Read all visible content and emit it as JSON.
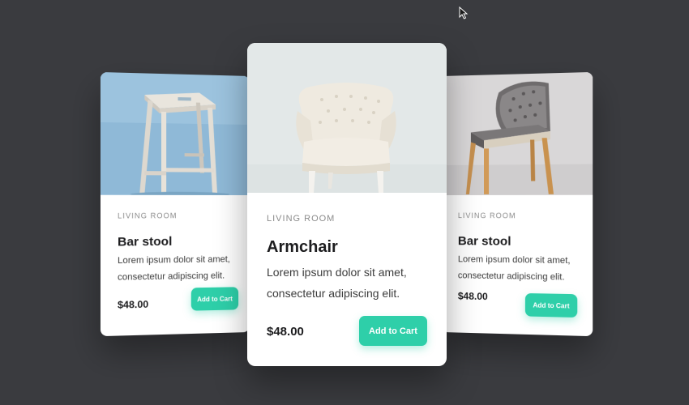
{
  "cards": [
    {
      "category": "LIVING ROOM",
      "title": "Bar stool",
      "description": "Lorem ipsum dolor sit amet, consectetur adipiscing elit.",
      "price": "$48.00",
      "button_label": "Add to Cart",
      "image": "bar-stool-photo"
    },
    {
      "category": "LIVING ROOM",
      "title": "Armchair",
      "description": "Lorem ipsum dolor sit amet, consectetur adipiscing elit.",
      "price": "$48.00",
      "button_label": "Add to Cart",
      "image": "armchair-photo"
    },
    {
      "category": "LIVING ROOM",
      "title": "Bar stool",
      "description": "Lorem ipsum dolor sit amet, consectetur adipiscing elit.",
      "price": "$48.00",
      "button_label": "Add to Cart",
      "image": "chair-photo"
    }
  ],
  "colors": {
    "background": "#3a3b3f",
    "accent": "#2ecfa9",
    "card": "#ffffff",
    "category_text": "#8b8b8b"
  },
  "icons": {
    "cursor": "mouse-pointer-icon"
  }
}
